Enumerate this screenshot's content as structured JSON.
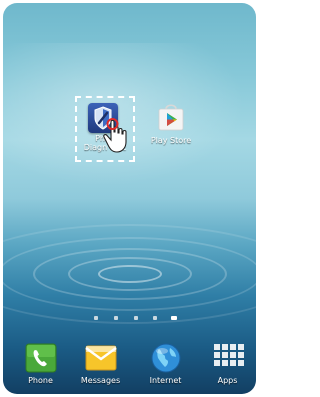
{
  "home_screen": {
    "shortcuts": [
      {
        "label": "Phone Diagnostic",
        "label_visible_part1": "Phon",
        "label_visible_part2": "Diagn",
        "label_visible_part3": "stic",
        "icon": "phone-diagnostic-icon",
        "selected": true
      },
      {
        "label": "Play Store",
        "icon": "play-store-icon",
        "selected": false
      }
    ],
    "page_indicator": {
      "count": 5,
      "active_index": 4
    }
  },
  "dock": {
    "items": [
      {
        "label": "Phone",
        "icon": "phone-icon"
      },
      {
        "label": "Messages",
        "icon": "messages-icon"
      },
      {
        "label": "Internet",
        "icon": "internet-globe-icon"
      },
      {
        "label": "Apps",
        "icon": "apps-grid-icon"
      }
    ]
  },
  "colors": {
    "selection_border": "#ffffff",
    "wallpaper_top": "#6fb8cc",
    "wallpaper_bottom": "#123f63"
  }
}
